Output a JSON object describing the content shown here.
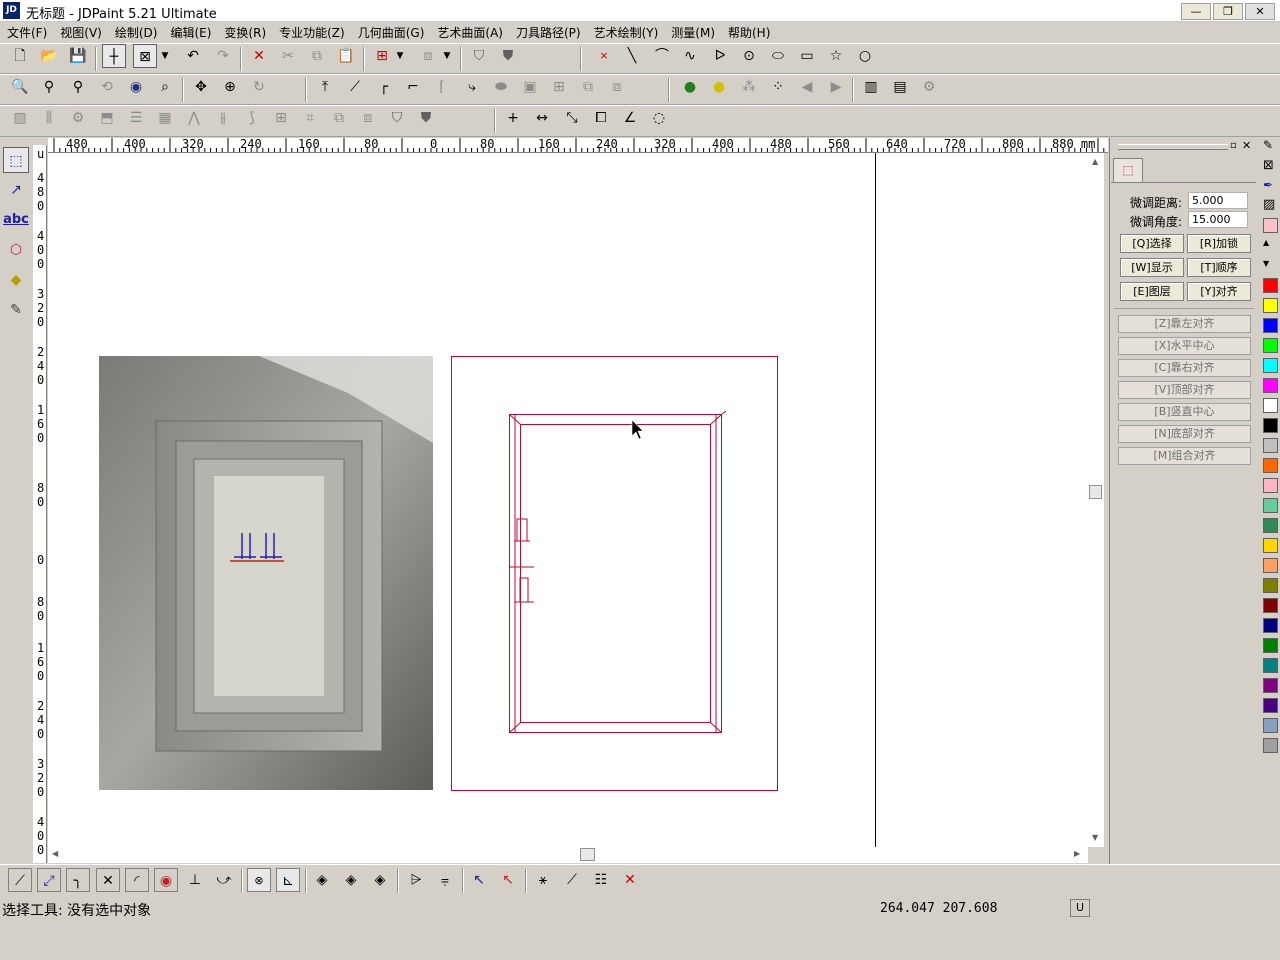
{
  "app": {
    "title": "无标题 - JDPaint 5.21 Ultimate",
    "icon_text": "JD"
  },
  "window_buttons": {
    "minimize": "—",
    "maximize": "❐",
    "close": "✕"
  },
  "menu": [
    "文件(F)",
    "视图(V)",
    "绘制(D)",
    "编辑(E)",
    "变换(R)",
    "专业功能(Z)",
    "几何曲面(G)",
    "艺术曲面(A)",
    "刀具路径(P)",
    "艺术绘制(Y)",
    "测量(M)",
    "帮助(H)"
  ],
  "ruler": {
    "h_labels": [
      "480",
      "400",
      "320",
      "240",
      "160",
      "80",
      "0",
      "80",
      "160",
      "240",
      "320",
      "400",
      "480",
      "560",
      "640",
      "720",
      "800",
      "880 mm"
    ],
    "v_labels": [
      "u",
      "480",
      "400",
      "320",
      "240",
      "160",
      "80",
      "0",
      "80",
      "160",
      "240",
      "320",
      "400"
    ]
  },
  "panel": {
    "distance_label": "微调距离:",
    "distance_value": "5.000",
    "angle_label": "微调角度:",
    "angle_value": "15.000",
    "buttons": [
      "[Q]选择",
      "[R]加锁",
      "[W]显示",
      "[T]顺序",
      "[E]图层",
      "[Y]对齐"
    ],
    "align_buttons": [
      "[Z]靠左对齐",
      "[X]水平中心",
      "[C]靠右对齐",
      "[V]顶部对齐",
      "[B]竖直中心",
      "[N]底部对齐",
      "[M]组合对齐"
    ]
  },
  "palette_colors": [
    "#ff0000",
    "#ffff00",
    "#0000ff",
    "#00ff00",
    "#00ffff",
    "#ff00ff",
    "#ffffff",
    "#000000",
    "#c0c0c0",
    "#ff6600",
    "#ffb6c1",
    "#66cc99",
    "#2e8b57",
    "#ffd700",
    "#ffa060",
    "#808000",
    "#800000",
    "#000080",
    "#008000",
    "#008080",
    "#800080",
    "#4b0082",
    "#87a0c0",
    "#a0a0a0"
  ],
  "status": {
    "text": "选择工具: 没有选中对象",
    "coords": "264.047  207.608",
    "unit_indicator": "U"
  }
}
